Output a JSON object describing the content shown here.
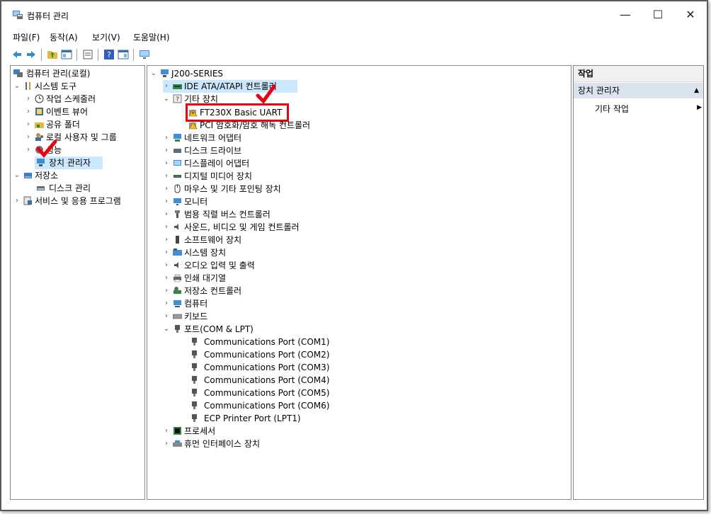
{
  "window": {
    "title": "컴퓨터 관리",
    "minimize": "—",
    "maximize": "☐",
    "close": "✕"
  },
  "menu": [
    "파일(F)",
    "동작(A)",
    "보기(V)",
    "도움말(H)"
  ],
  "left_tree": [
    {
      "label": "컴퓨터 관리(로컬)",
      "icon": "computer-management-icon"
    },
    {
      "label": "시스템 도구",
      "icon": "tools-icon"
    },
    {
      "label": "작업 스케줄러",
      "icon": "clock-icon"
    },
    {
      "label": "이벤트 뷰어",
      "icon": "event-viewer-icon"
    },
    {
      "label": "공유 폴더",
      "icon": "shared-folder-icon"
    },
    {
      "label": "로컬 사용자 및 그룹",
      "icon": "users-icon"
    },
    {
      "label": "성능",
      "icon": "performance-icon"
    },
    {
      "label": "장치 관리자",
      "icon": "device-manager-icon"
    },
    {
      "label": "저장소",
      "icon": "storage-icon"
    },
    {
      "label": "디스크 관리",
      "icon": "disk-management-icon"
    },
    {
      "label": "서비스 및 응용 프로그램",
      "icon": "services-icon"
    }
  ],
  "device_tree": {
    "root": "J200-SERIES",
    "items": [
      "IDE ATA/ATAPI 컨트롤러",
      "기타 장치",
      "FT230X Basic UART",
      "PCI 암호화/암호 해독 컨트롤러",
      "네트워크 어댑터",
      "디스크 드라이브",
      "디스플레이 어댑터",
      "디지털 미디어 장치",
      "마우스 및 기타 포인팅 장치",
      "모니터",
      "범용 직렬 버스 컨트롤러",
      "사운드, 비디오 및 게임 컨트롤러",
      "소프트웨어 장치",
      "시스템 장치",
      "오디오 입력 및 출력",
      "인쇄 대기열",
      "저장소 컨트롤러",
      "컴퓨터",
      "키보드",
      "포트(COM & LPT)",
      "Communications Port (COM1)",
      "Communications Port (COM2)",
      "Communications Port (COM3)",
      "Communications Port (COM4)",
      "Communications Port (COM5)",
      "Communications Port (COM6)",
      "ECP Printer Port (LPT1)",
      "프로세서",
      "휴먼 인터페이스 장치"
    ]
  },
  "actions": {
    "header": "작업",
    "selected": "장치 관리자",
    "more": "기타 작업"
  },
  "colors": {
    "highlight_box": "#e60012",
    "selection": "#cce8ff",
    "action_selected": "#dbe4ee"
  }
}
